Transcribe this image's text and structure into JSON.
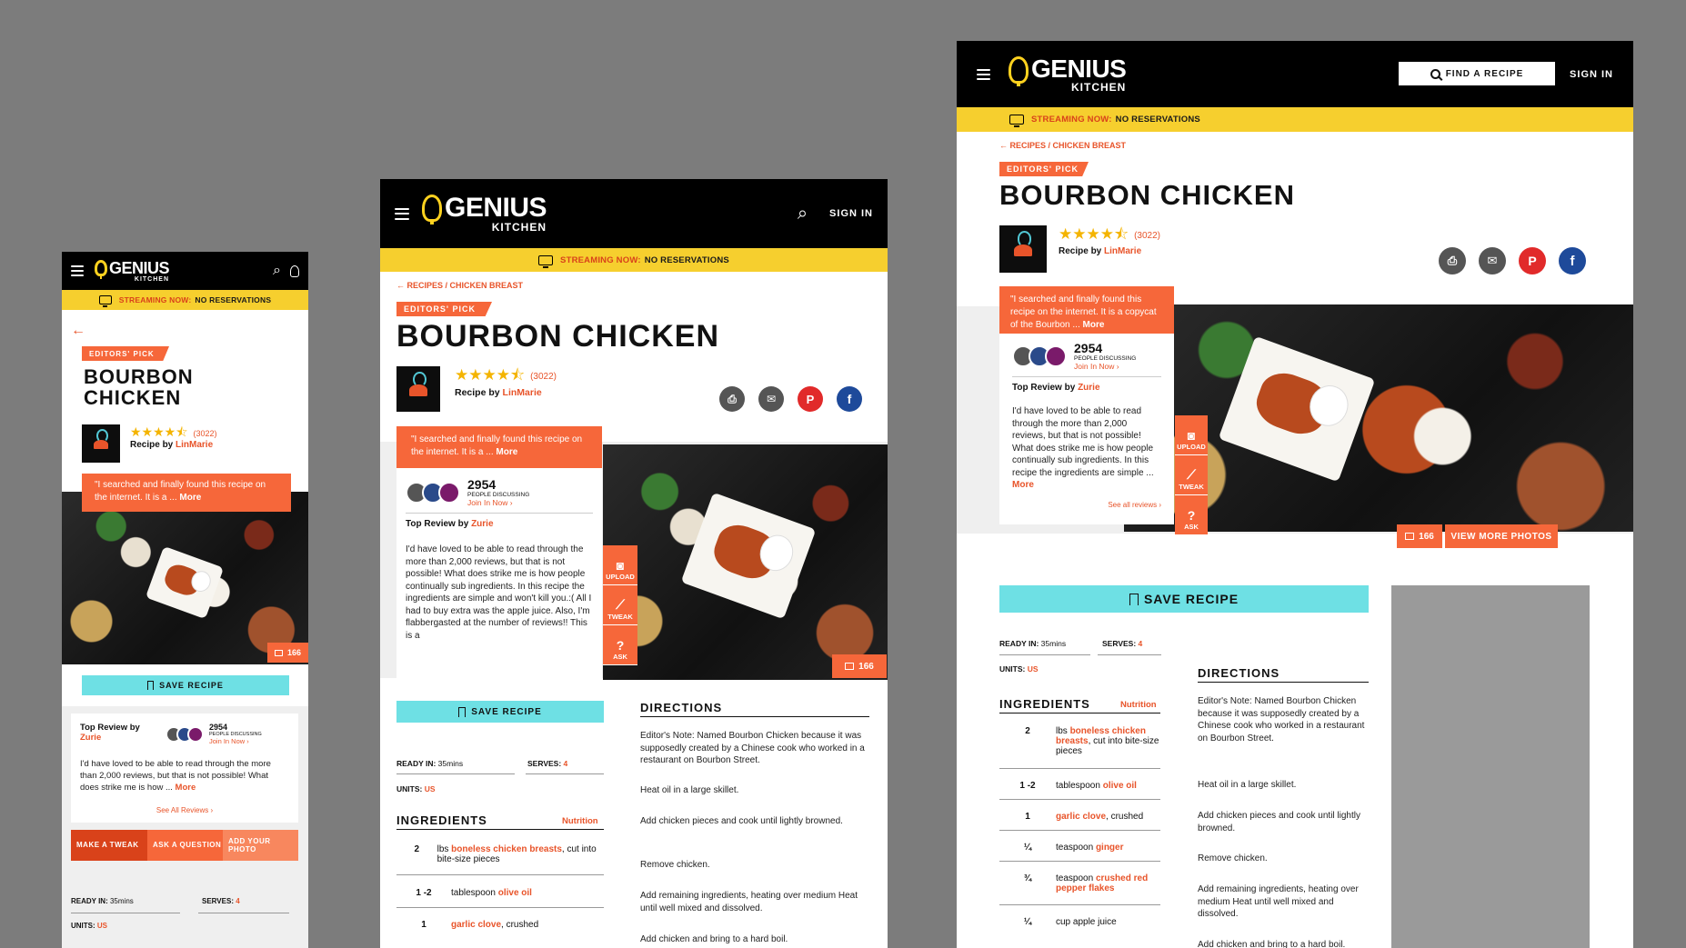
{
  "brand": {
    "name": "GENIUS",
    "sub": "KITCHEN"
  },
  "header": {
    "sign_in": "SIGN IN",
    "find_recipe": "FIND A RECIPE"
  },
  "stream": {
    "label": "STREAMING NOW:",
    "value": "NO RESERVATIONS"
  },
  "breadcrumb": {
    "recipes": "RECIPES /",
    "category": "CHICKEN BREAST"
  },
  "recipe": {
    "badge": "EDITORS' PICK",
    "title": "BOURBON CHICKEN",
    "title_line1": "BOURBON",
    "title_line2": "CHICKEN",
    "stars": "★★★★⯪",
    "rating_count": "(3022)",
    "recipe_by": "Recipe by",
    "author": "LinMarie",
    "quote_short": "\"I searched and finally found this recipe on the internet. It is a ... ",
    "quote_desktop": "\"I searched and finally found this recipe on the internet. It is a copycat of the Bourbon ... ",
    "more": "More",
    "photo_count": "166",
    "view_more_photos": "VIEW MORE PHOTOS"
  },
  "discussion": {
    "count": "2954",
    "label": "PEOPLE DISCUSSING",
    "join": "Join In Now ›"
  },
  "review": {
    "by": "Top Review by",
    "reviewer": "Zurie",
    "text_tablet": "I'd have loved to be able to read through the more than 2,000 reviews, but that is not possible! What does strike me is how people continually sub ingredients. In this recipe the ingredients are simple and won't kill you.:( All I had to buy extra was the apple juice. Also, I'm flabbergasted at the number of reviews!! This is a",
    "text_desktop": "I'd have loved to be able to read through the more than 2,000 reviews, but that is not possible! What does strike me is how people continually sub ingredients. In this recipe the ingredients are simple ... ",
    "text_mobile": "I'd have loved to be able to read through the more than 2,000 reviews, but that is not possible! What does strike me is how ... ",
    "more": "More",
    "see_all": "See all reviews ›",
    "see_all_mobile": "See All Reviews ›"
  },
  "actions": {
    "upload": "UPLOAD",
    "tweak": "TWEAK",
    "ask": "ASK",
    "make_tweak": "MAKE A TWEAK",
    "ask_question": "ASK A QUESTION",
    "add_photo": "ADD YOUR PHOTO"
  },
  "save": "SAVE RECIPE",
  "meta": {
    "ready_label": "READY IN:",
    "ready": "35mins",
    "serves_label": "SERVES:",
    "serves": "4",
    "units_label": "UNITS:",
    "units": "US"
  },
  "ingredients": {
    "title": "INGREDIENTS",
    "nutrition": "Nutrition",
    "items": [
      {
        "qty": "2",
        "unit": "lbs",
        "name": "boneless chicken breasts",
        "rest": ", cut into bite-size pieces"
      },
      {
        "qty": "1 -2",
        "unit": "tablespoon",
        "name": "olive oil",
        "rest": ""
      },
      {
        "qty": "1",
        "unit": "",
        "name": "garlic clove",
        "rest": ", crushed"
      },
      {
        "qty": "¼",
        "unit": "teaspoon",
        "name": "ginger",
        "rest": ""
      },
      {
        "qty": "¾",
        "unit": "teaspoon",
        "name": "crushed red pepper flakes",
        "rest": ""
      },
      {
        "qty": "¼",
        "unit": "cup apple juice",
        "name": "",
        "rest": ""
      }
    ]
  },
  "directions": {
    "title": "DIRECTIONS",
    "steps": [
      "Editor's Note: Named Bourbon Chicken because it was supposedly created by a Chinese cook who worked in a restaurant on Bourbon Street.",
      "Heat oil in a large skillet.",
      "Add chicken pieces and cook until lightly browned.",
      "Remove chicken.",
      "Add remaining ingredients, heating over medium Heat until well mixed and dissolved.",
      "Add chicken and bring to a hard boil."
    ]
  },
  "colors": {
    "accent": "#f6673a",
    "yellow": "#f6cf2e",
    "teal": "#6ee0e4",
    "brand_red": "#e8542a"
  }
}
